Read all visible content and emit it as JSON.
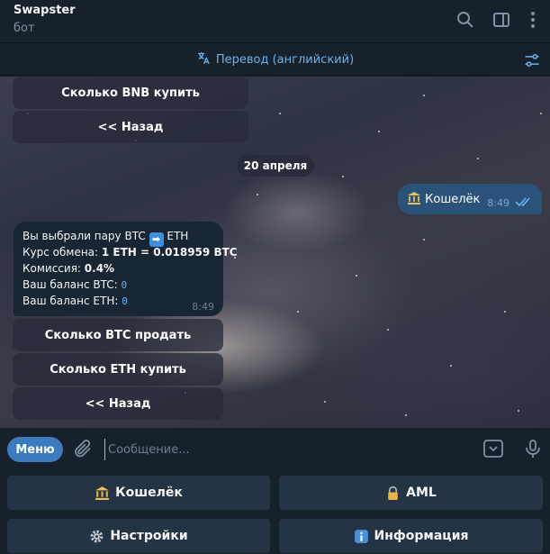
{
  "header": {
    "title": "Swapster",
    "subtitle": "бот",
    "icons": [
      "search-icon",
      "sidebar-toggle-icon",
      "more-vertical-icon"
    ]
  },
  "translate_bar": {
    "label": "Перевод (английский)",
    "icons": [
      "translate-icon",
      "translate-settings-icon"
    ]
  },
  "chat": {
    "top_keyboard": [
      {
        "label": "Сколько BNB купить"
      },
      {
        "label": "<< Назад"
      }
    ],
    "date_separator": "20 апреля",
    "outgoing_message": {
      "text": "Кошелёк",
      "emoji": "bank-icon",
      "time": "8:49",
      "status": "read"
    },
    "incoming_message": {
      "line1_prefix": "Вы выбрали пару BTC",
      "line1_emoji": "➡",
      "line1_suffix": "ETH",
      "line2_label": "Курс обмена: ",
      "line2_value": "1 ETH = 0.018959 BTC",
      "line3_label": "Комиссия: ",
      "line3_value": "0.4%",
      "line4_label": "Ваш баланс BTC: ",
      "line4_value": "0",
      "line5_label": "Ваш баланс ETH: ",
      "line5_value": "0",
      "time": "8:49"
    },
    "inline_keyboard": [
      {
        "label": "Сколько BTC продать"
      },
      {
        "label": "Сколько ETH купить"
      },
      {
        "label": "<< Назад"
      }
    ]
  },
  "input_bar": {
    "menu_label": "Меню",
    "placeholder": "Сообщение...",
    "value": ""
  },
  "reply_keyboard": {
    "buttons": [
      {
        "label": "Кошелёк",
        "icon": "bank-icon"
      },
      {
        "label": "AML",
        "icon": "lock-icon"
      },
      {
        "label": "Настройки",
        "icon": "gear-icon"
      },
      {
        "label": "Информация",
        "icon": "info-icon"
      }
    ]
  },
  "colors": {
    "background": "#17212b",
    "accent": "#6ab3f3",
    "outgoing_bubble": "#2b5278",
    "incoming_bubble": "#182533",
    "menu_button": "#3c7bbd",
    "keyboard_button": "#253444"
  }
}
